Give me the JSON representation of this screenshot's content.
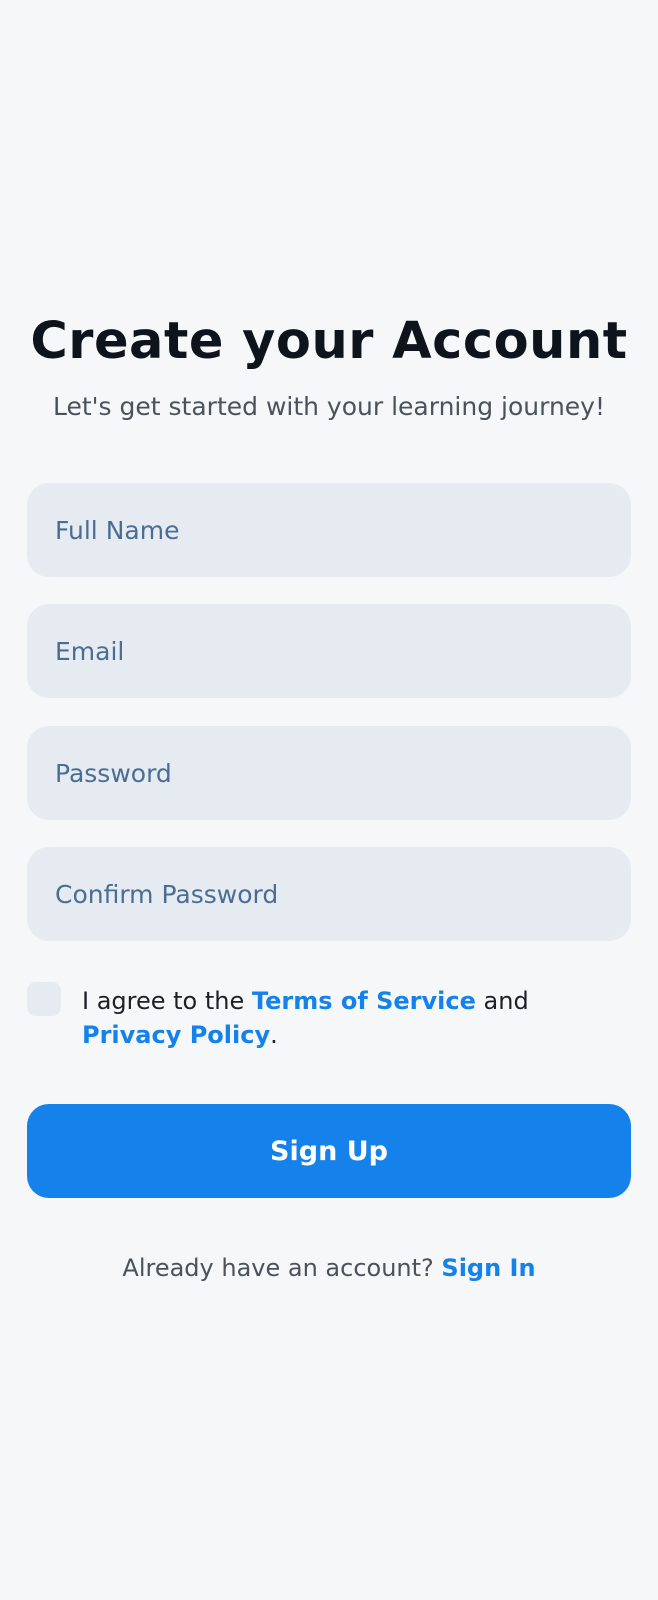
{
  "header": {
    "title": "Create your Account",
    "subtitle": "Let's get started with your learning journey!"
  },
  "form": {
    "full_name": {
      "value": "",
      "placeholder": "Full Name"
    },
    "email": {
      "value": "",
      "placeholder": "Email"
    },
    "password": {
      "value": "",
      "placeholder": "Password"
    },
    "confirm_password": {
      "value": "",
      "placeholder": "Confirm Password"
    },
    "agree": {
      "checked": false,
      "prefix": "I agree to the ",
      "terms_link": "Terms of Service",
      "middle": " and ",
      "privacy_link": "Privacy Policy",
      "suffix": "."
    },
    "submit_label": "Sign Up"
  },
  "footer": {
    "prompt": "Already have an account? ",
    "signin_link": "Sign In"
  },
  "colors": {
    "accent": "#1582eb",
    "background": "#f5f7f9",
    "field_background": "#e6ebf2",
    "placeholder": "#4a6d94",
    "title_text": "#0e141b",
    "body_text": "#4a525c"
  }
}
